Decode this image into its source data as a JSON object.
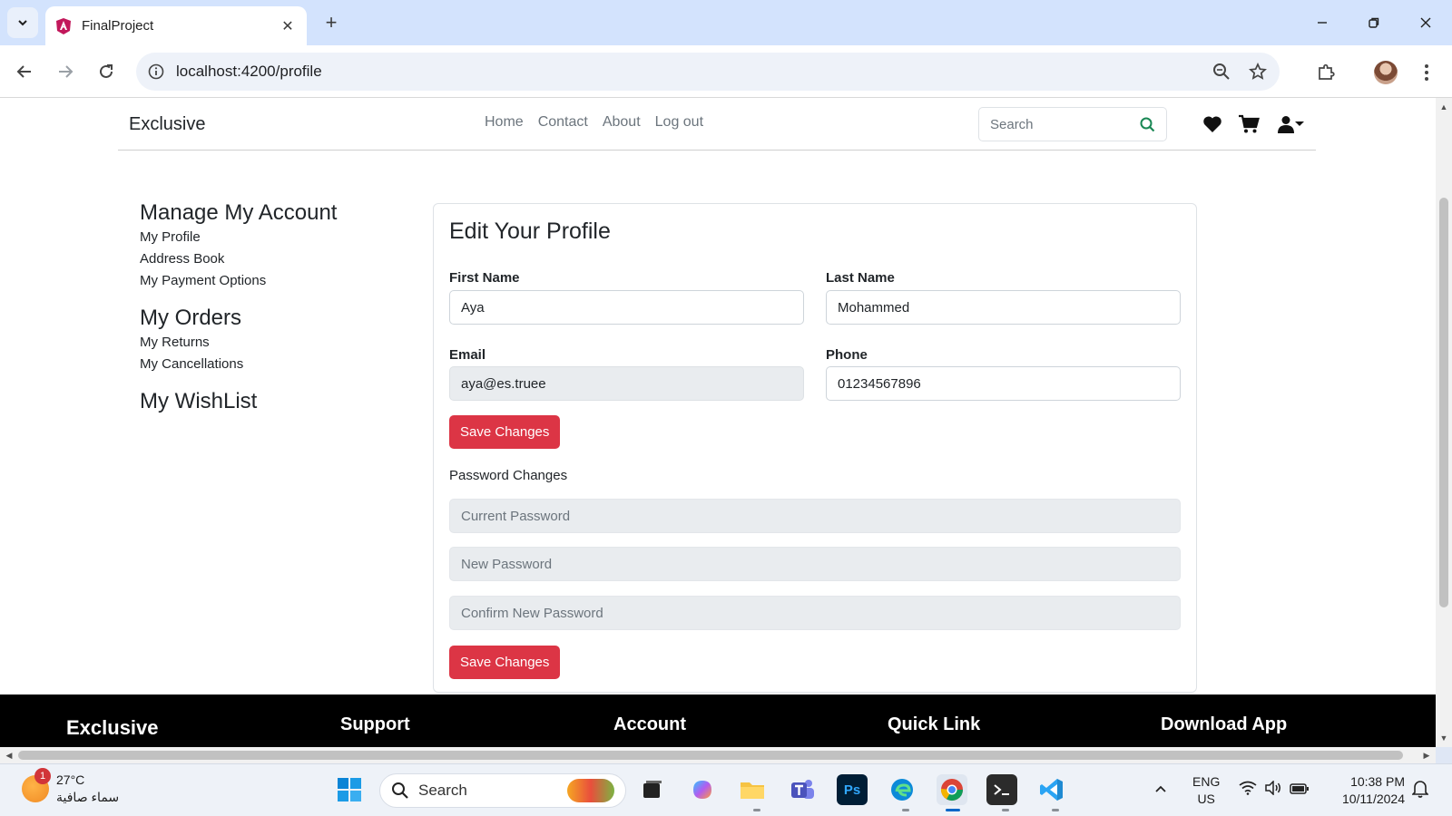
{
  "browser": {
    "tab_title": "FinalProject",
    "url": "localhost:4200/profile"
  },
  "site": {
    "brand": "Exclusive",
    "nav_links": [
      "Home",
      "Contact",
      "About",
      "Log out"
    ],
    "search_placeholder": "Search"
  },
  "sidebar": {
    "sections": [
      {
        "heading": "Manage My Account",
        "links": [
          "My Profile",
          "Address Book",
          "My Payment Options"
        ]
      },
      {
        "heading": "My Orders",
        "links": [
          "My Returns",
          "My Cancellations"
        ]
      },
      {
        "heading": "My WishList",
        "links": []
      }
    ]
  },
  "profile": {
    "title": "Edit Your Profile",
    "first_name_label": "First Name",
    "first_name": "Aya",
    "last_name_label": "Last Name",
    "last_name": "Mohammed",
    "email_label": "Email",
    "email": "aya@es.truee",
    "phone_label": "Phone",
    "phone": "01234567896",
    "save_label": "Save Changes",
    "password_title": "Password Changes",
    "current_password_placeholder": "Current Password",
    "new_password_placeholder": "New Password",
    "confirm_password_placeholder": "Confirm New Password",
    "save_password_label": "Save Changes"
  },
  "footer": {
    "columns": [
      "Exclusive",
      "Support",
      "Account",
      "Quick Link",
      "Download App"
    ]
  },
  "taskbar": {
    "weather_badge": "1",
    "temperature": "27°C",
    "weather_desc": "سماء صافية",
    "search_placeholder": "Search",
    "lang_line1": "ENG",
    "lang_line2": "US",
    "time": "10:38 PM",
    "date": "10/11/2024"
  },
  "colors": {
    "primary_button": "#dc3545",
    "footer_bg": "#000000",
    "search_icon": "#198754"
  }
}
